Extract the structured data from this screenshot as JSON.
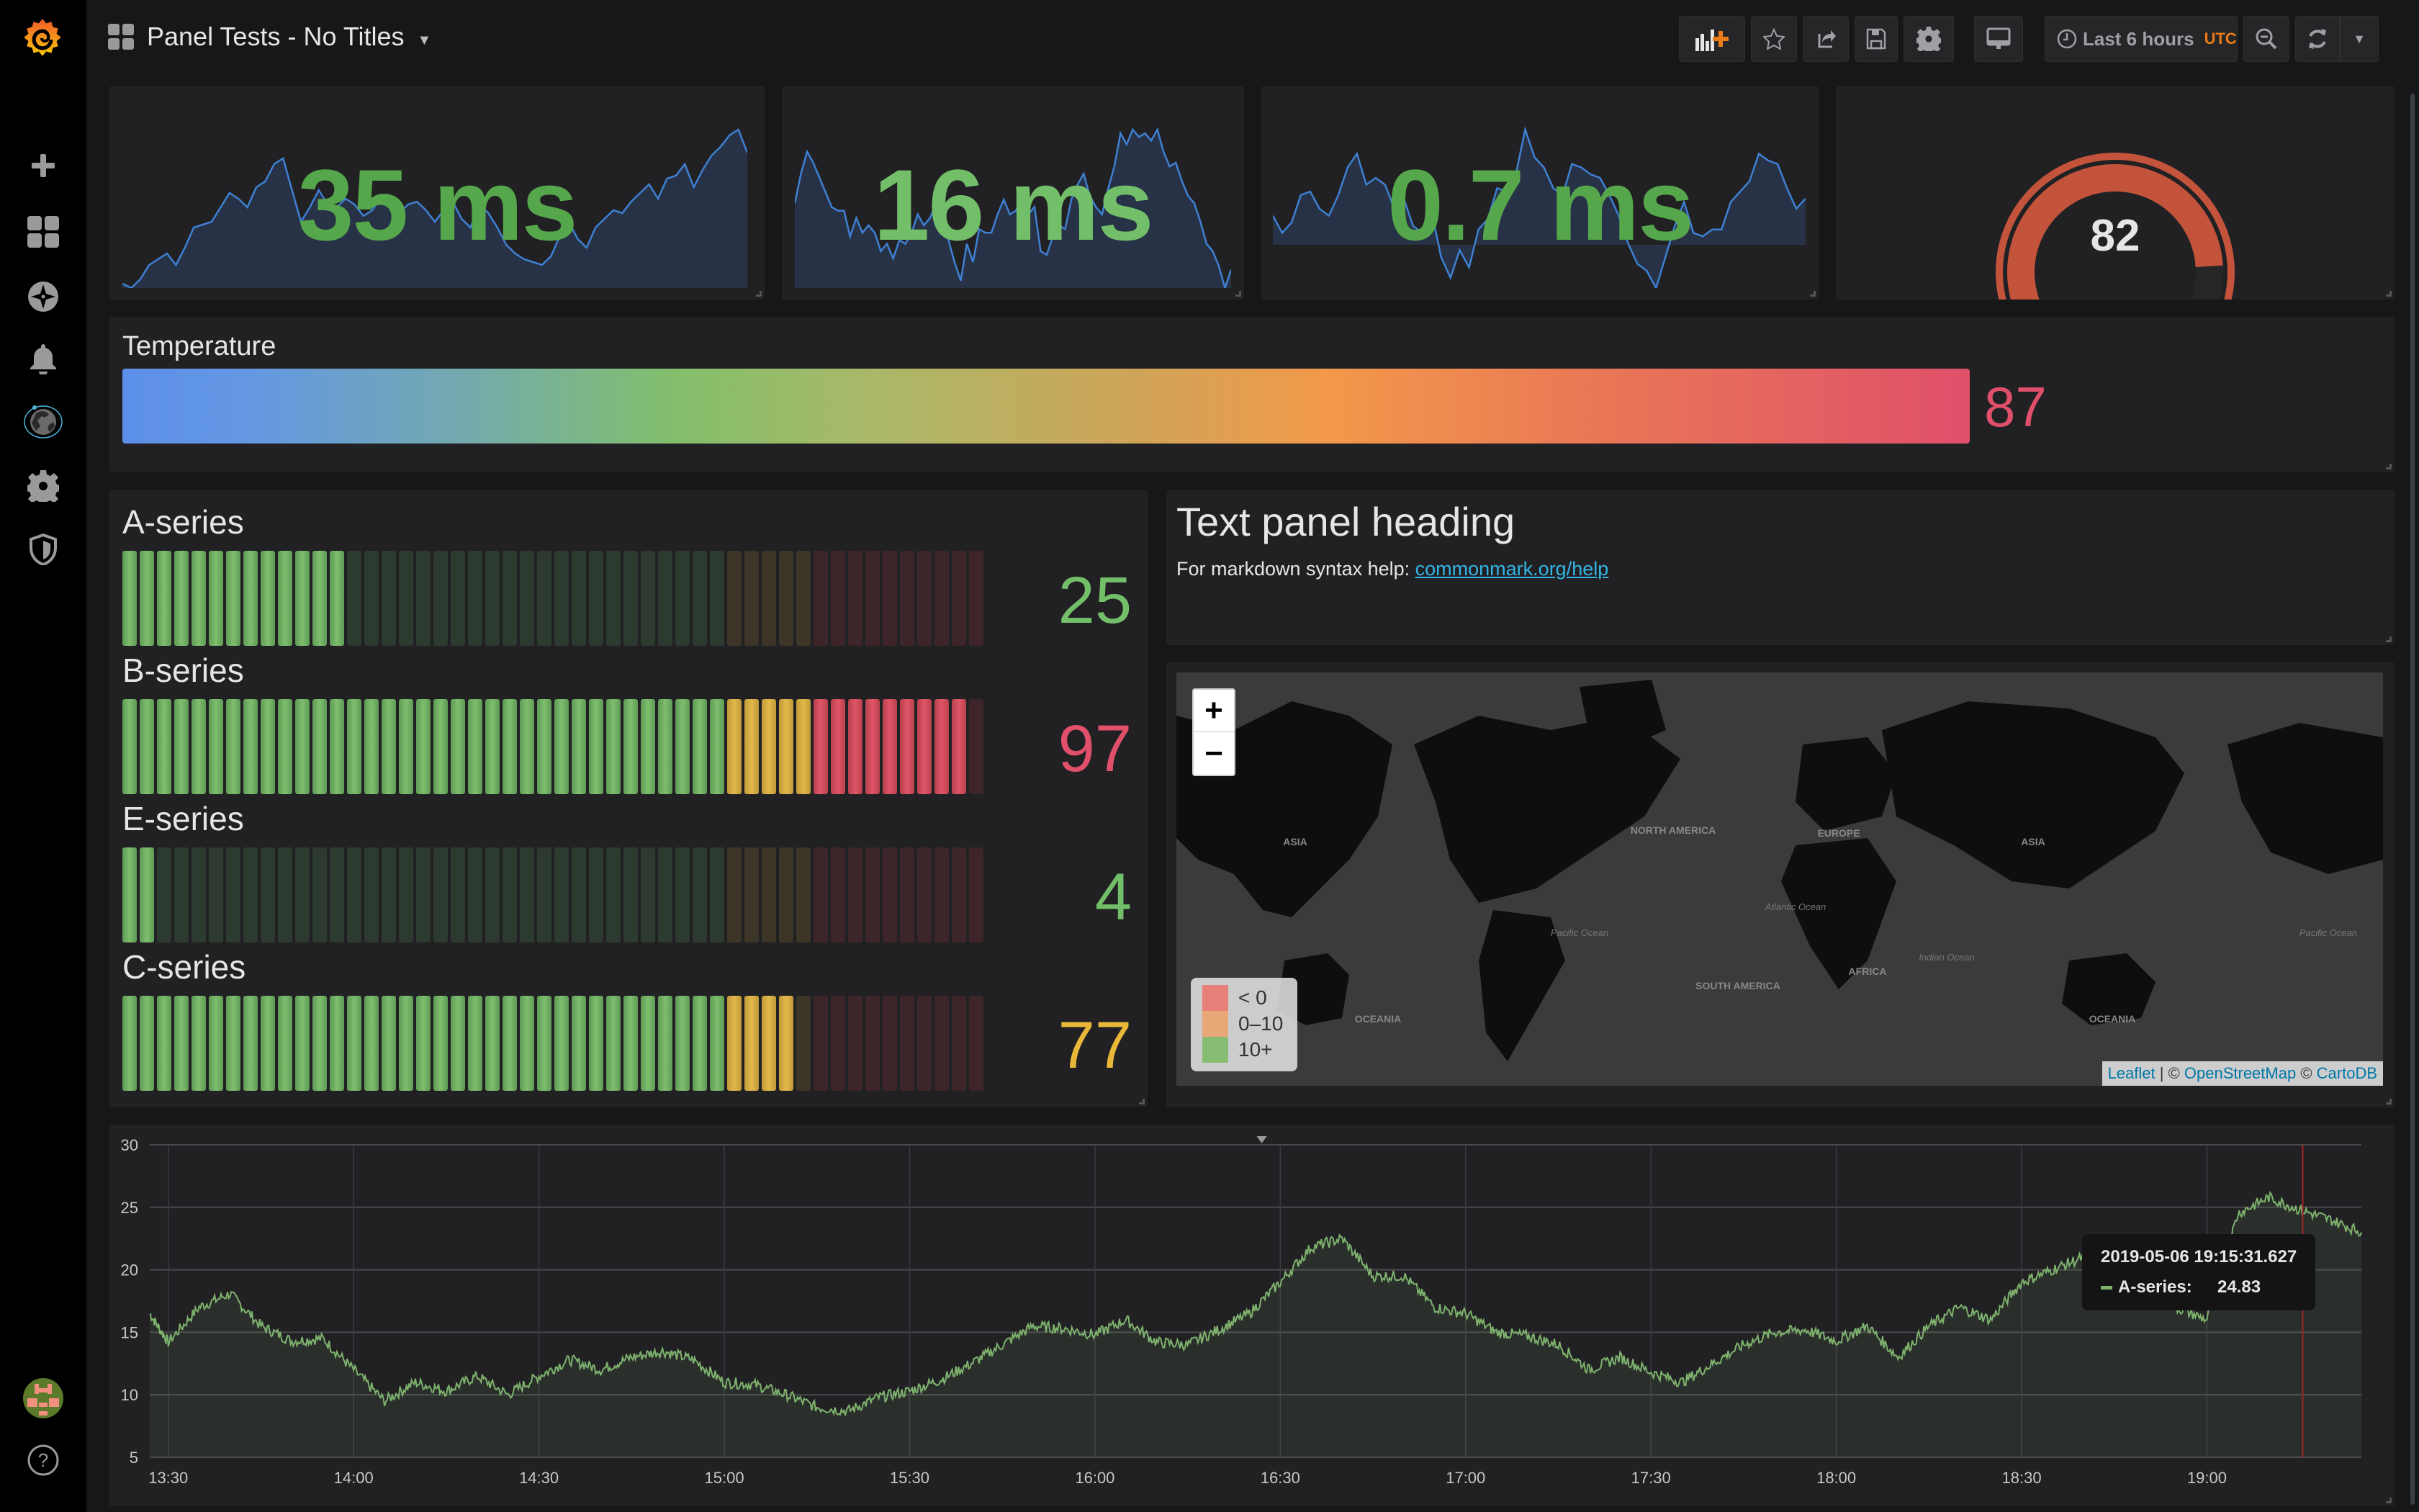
{
  "header": {
    "dashboard_title": "Panel Tests - No Titles",
    "time_range": "Last 6 hours",
    "timezone": "UTC",
    "toolbar": {
      "add_panel": "add-panel",
      "star": "star",
      "share": "share",
      "save": "save",
      "settings": "settings",
      "tv_mode": "tv-mode",
      "zoom_out": "zoom-out",
      "refresh": "refresh",
      "refresh_interval": "refresh-interval"
    }
  },
  "sidebar": {
    "items": [
      {
        "icon": "plus-icon",
        "label": "Create"
      },
      {
        "icon": "dashboards-icon",
        "label": "Dashboards"
      },
      {
        "icon": "compass-icon",
        "label": "Explore"
      },
      {
        "icon": "bell-icon",
        "label": "Alerting"
      },
      {
        "icon": "globe-icon",
        "label": "Plugins"
      },
      {
        "icon": "gear-icon",
        "label": "Configuration"
      },
      {
        "icon": "shield-icon",
        "label": "Server Admin"
      }
    ],
    "bottom": [
      {
        "icon": "avatar",
        "label": "Profile"
      },
      {
        "icon": "help-icon",
        "label": "Help"
      }
    ]
  },
  "singlestats": [
    {
      "value": "35 ms",
      "color": "#56a64b",
      "spark": [
        5,
        2,
        8,
        18,
        22,
        26,
        18,
        30,
        44,
        46,
        48,
        58,
        68,
        64,
        58,
        72,
        76,
        88,
        92,
        70,
        48,
        58,
        70,
        60,
        58,
        64,
        60,
        52,
        56,
        66,
        58,
        54,
        60,
        62,
        56,
        48,
        56,
        62,
        50,
        44,
        60,
        54,
        44,
        32,
        26,
        22,
        20,
        18,
        24,
        38,
        48,
        36,
        30,
        44,
        50,
        56,
        54,
        62,
        68,
        74,
        64,
        78,
        80,
        88,
        72,
        84,
        94,
        100,
        108,
        112,
        96
      ]
    },
    {
      "value": "16 ms",
      "color": "#73bf69",
      "spark": [
        50,
        66,
        78,
        72,
        64,
        56,
        48,
        46,
        46,
        32,
        42,
        34,
        38,
        34,
        24,
        28,
        20,
        30,
        28,
        34,
        44,
        38,
        42,
        50,
        44,
        30,
        18,
        8,
        28,
        18,
        36,
        34,
        34,
        44,
        52,
        44,
        46,
        56,
        44,
        48,
        24,
        22,
        32,
        38,
        36,
        52,
        60,
        66,
        54,
        48,
        44,
        58,
        70,
        88,
        82,
        90,
        86,
        88,
        84,
        90,
        78,
        70,
        72,
        62,
        54,
        50,
        40,
        28,
        24,
        16,
        4,
        14
      ]
    },
    {
      "value": "0.7 ms",
      "color": "#56a64b",
      "spark": [
        46,
        36,
        42,
        58,
        60,
        50,
        46,
        58,
        74,
        82,
        64,
        68,
        64,
        50,
        56,
        40,
        36,
        48,
        22,
        10,
        26,
        16,
        38,
        44,
        62,
        60,
        70,
        96,
        80,
        74,
        62,
        58,
        76,
        74,
        70,
        68,
        58,
        46,
        30,
        18,
        14,
        4,
        22,
        40,
        54,
        36,
        34,
        38,
        38,
        54,
        60,
        66,
        82,
        78,
        76,
        62,
        50,
        56
      ]
    }
  ],
  "gauge": {
    "value": "82",
    "value_fraction": 0.82,
    "color": "#c4533b"
  },
  "bargauge": {
    "label": "Temperature",
    "value": "87",
    "value_color": "#e0506a",
    "fraction": 0.87
  },
  "lcd_gauges": [
    {
      "label": "A-series",
      "value": "25",
      "value_color": "#73bf69",
      "value_num": 25
    },
    {
      "label": "B-series",
      "value": "97",
      "value_color": "#e0506a",
      "value_num": 97
    },
    {
      "label": "E-series",
      "value": "4",
      "value_color": "#73bf69",
      "value_num": 4
    },
    {
      "label": "C-series",
      "value": "77",
      "value_color": "#eab839",
      "value_num": 77
    }
  ],
  "text_panel": {
    "heading": "Text panel heading",
    "body": "For markdown syntax help: ",
    "link": "commonmark.org/help"
  },
  "worldmap": {
    "zoom_in": "+",
    "zoom_out": "−",
    "legend": [
      {
        "label": "< 0",
        "color": "#e8807a"
      },
      {
        "label": "0–10",
        "color": "#e8a878"
      },
      {
        "label": "10+",
        "color": "#86bd72"
      }
    ],
    "continent_labels": [
      "ASIA",
      "NORTH AMERICA",
      "EUROPE",
      "AFRICA",
      "SOUTH AMERICA",
      "OCEANIA",
      "ASIA",
      "OCEANIA"
    ],
    "ocean_labels": [
      "Pacific Ocean",
      "Atlantic Ocean",
      "Indian Ocean",
      "Pacific Ocean"
    ],
    "attribution": {
      "leaflet": "Leaflet",
      "sep": " | © ",
      "osm": "OpenStreetMap",
      "sep2": " © ",
      "carto": "CartoDB"
    }
  },
  "tooltip": {
    "time": "2019-05-06 19:15:31.627",
    "series": "A-series:",
    "value": "24.83"
  },
  "chart_data": {
    "type": "area",
    "title": "",
    "xlabel": "",
    "ylabel": "",
    "ylim": [
      5,
      30
    ],
    "yticks": [
      "30",
      "25",
      "20",
      "15",
      "10",
      "5"
    ],
    "xticks": [
      "13:30",
      "14:00",
      "14:30",
      "15:00",
      "15:30",
      "16:00",
      "16:30",
      "17:00",
      "17:30",
      "18:00",
      "18:30",
      "19:00"
    ],
    "x_range_minutes": [
      -3,
      355
    ],
    "grid": true,
    "legend": "none",
    "series": [
      {
        "name": "A-series",
        "color": "#7eb26d",
        "x_minutes": [
          -3,
          0,
          5,
          10,
          15,
          20,
          25,
          30,
          35,
          40,
          45,
          50,
          55,
          60,
          65,
          70,
          75,
          80,
          85,
          90,
          95,
          100,
          105,
          110,
          115,
          120,
          125,
          130,
          135,
          140,
          145,
          150,
          155,
          160,
          165,
          170,
          175,
          180,
          185,
          190,
          195,
          200,
          205,
          210,
          215,
          220,
          225,
          230,
          235,
          240,
          245,
          250,
          255,
          260,
          265,
          270,
          275,
          280,
          285,
          290,
          295,
          300,
          305,
          310,
          315,
          320,
          325,
          330,
          335,
          340,
          345,
          350,
          355
        ],
        "values": [
          16.5,
          14.2,
          17.0,
          18.1,
          15.5,
          14.3,
          14.5,
          12.0,
          9.5,
          11.0,
          10.3,
          11.5,
          10.0,
          11.5,
          12.8,
          12.0,
          13.0,
          13.5,
          12.8,
          11.0,
          10.8,
          10.0,
          9.0,
          8.7,
          9.8,
          10.3,
          11.2,
          12.5,
          14.0,
          15.5,
          15.3,
          14.8,
          16.0,
          14.2,
          14.0,
          15.2,
          16.5,
          19.0,
          21.8,
          22.5,
          19.5,
          19.5,
          17.0,
          16.5,
          15.0,
          14.7,
          14.0,
          12.0,
          13.0,
          11.8,
          11.0,
          12.5,
          14.0,
          15.0,
          15.2,
          14.3,
          15.5,
          13.0,
          15.5,
          17.0,
          16.0,
          19.0,
          20.0,
          21.0,
          21.5,
          19.5,
          17.0,
          16.0,
          24.5,
          25.8,
          24.8,
          24.0,
          23.0
        ]
      }
    ],
    "crosshair_time": "19:15:31.627"
  }
}
